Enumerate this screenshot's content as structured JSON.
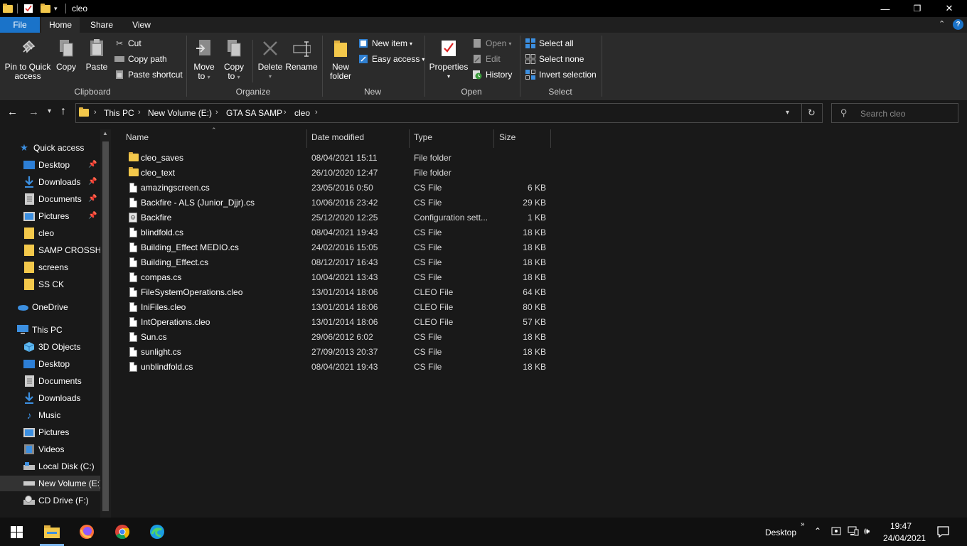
{
  "window": {
    "title": "cleo",
    "minimize_glyph": "—",
    "maximize_glyph": "❐",
    "close_glyph": "✕"
  },
  "tabs": [
    {
      "label": "File"
    },
    {
      "label": "Home"
    },
    {
      "label": "Share"
    },
    {
      "label": "View"
    }
  ],
  "ribbon": {
    "clipboard": {
      "pin_label_1": "Pin to Quick",
      "pin_label_2": "access",
      "copy_label": "Copy",
      "paste_label": "Paste",
      "cut_label": "Cut",
      "copy_path_label": "Copy path",
      "paste_shortcut_label": "Paste shortcut",
      "group_label": "Clipboard"
    },
    "organize": {
      "move_to_1": "Move",
      "move_to_2": "to",
      "copy_to_1": "Copy",
      "copy_to_2": "to",
      "delete_label": "Delete",
      "rename_label": "Rename",
      "group_label": "Organize"
    },
    "new": {
      "new_folder_1": "New",
      "new_folder_2": "folder",
      "new_item_label": "New item",
      "easy_access_label": "Easy access",
      "group_label": "New"
    },
    "open": {
      "properties_label": "Properties",
      "open_label": "Open",
      "edit_label": "Edit",
      "history_label": "History",
      "group_label": "Open"
    },
    "select": {
      "select_all_label": "Select all",
      "select_none_label": "Select none",
      "invert_selection_label": "Invert selection",
      "group_label": "Select"
    }
  },
  "address": {
    "crumbs": [
      "This PC",
      "New Volume (E:)",
      "GTA SA SAMP",
      "cleo"
    ],
    "search_placeholder": "Search cleo"
  },
  "nav": {
    "quick_access": "Quick access",
    "quick_items": [
      {
        "label": "Desktop",
        "pinned": true
      },
      {
        "label": "Downloads",
        "pinned": true
      },
      {
        "label": "Documents",
        "pinned": true
      },
      {
        "label": "Pictures",
        "pinned": true
      },
      {
        "label": "cleo"
      },
      {
        "label": "SAMP CROSSHA"
      },
      {
        "label": "screens"
      },
      {
        "label": "SS CK"
      }
    ],
    "onedrive": "OneDrive",
    "this_pc": "This PC",
    "pc_items": [
      {
        "label": "3D Objects"
      },
      {
        "label": "Desktop"
      },
      {
        "label": "Documents"
      },
      {
        "label": "Downloads"
      },
      {
        "label": "Music"
      },
      {
        "label": "Pictures"
      },
      {
        "label": "Videos"
      },
      {
        "label": "Local Disk (C:)"
      },
      {
        "label": "New Volume (E:)"
      },
      {
        "label": "CD Drive (F:)"
      }
    ]
  },
  "columns": {
    "name": "Name",
    "date": "Date modified",
    "type": "Type",
    "size": "Size"
  },
  "files": [
    {
      "name": "cleo_saves",
      "date": "08/04/2021 15:11",
      "type": "File folder",
      "size": "",
      "kind": "folder"
    },
    {
      "name": "cleo_text",
      "date": "26/10/2020 12:47",
      "type": "File folder",
      "size": "",
      "kind": "folder"
    },
    {
      "name": "amazingscreen.cs",
      "date": "23/05/2016 0:50",
      "type": "CS File",
      "size": "6 KB",
      "kind": "file"
    },
    {
      "name": "Backfire - ALS (Junior_Djjr).cs",
      "date": "10/06/2016 23:42",
      "type": "CS File",
      "size": "29 KB",
      "kind": "file"
    },
    {
      "name": "Backfire",
      "date": "25/12/2020 12:25",
      "type": "Configuration sett...",
      "size": "1 KB",
      "kind": "config"
    },
    {
      "name": "blindfold.cs",
      "date": "08/04/2021 19:43",
      "type": "CS File",
      "size": "18 KB",
      "kind": "file"
    },
    {
      "name": "Building_Effect MEDIO.cs",
      "date": "24/02/2016 15:05",
      "type": "CS File",
      "size": "18 KB",
      "kind": "file"
    },
    {
      "name": "Building_Effect.cs",
      "date": "08/12/2017 16:43",
      "type": "CS File",
      "size": "18 KB",
      "kind": "file"
    },
    {
      "name": "compas.cs",
      "date": "10/04/2021 13:43",
      "type": "CS File",
      "size": "18 KB",
      "kind": "file"
    },
    {
      "name": "FileSystemOperations.cleo",
      "date": "13/01/2014 18:06",
      "type": "CLEO File",
      "size": "64 KB",
      "kind": "file"
    },
    {
      "name": "IniFiles.cleo",
      "date": "13/01/2014 18:06",
      "type": "CLEO File",
      "size": "80 KB",
      "kind": "file"
    },
    {
      "name": "IntOperations.cleo",
      "date": "13/01/2014 18:06",
      "type": "CLEO File",
      "size": "57 KB",
      "kind": "file"
    },
    {
      "name": "Sun.cs",
      "date": "29/06/2012 6:02",
      "type": "CS File",
      "size": "18 KB",
      "kind": "file"
    },
    {
      "name": "sunlight.cs",
      "date": "27/09/2013 20:37",
      "type": "CS File",
      "size": "18 KB",
      "kind": "file"
    },
    {
      "name": "unblindfold.cs",
      "date": "08/04/2021 19:43",
      "type": "CS File",
      "size": "18 KB",
      "kind": "file"
    }
  ],
  "taskbar": {
    "desktop_label": "Desktop",
    "time": "19:47",
    "date": "24/04/2021"
  },
  "colors": {
    "accent": "#0078d7",
    "folder": "#f3c84b"
  }
}
